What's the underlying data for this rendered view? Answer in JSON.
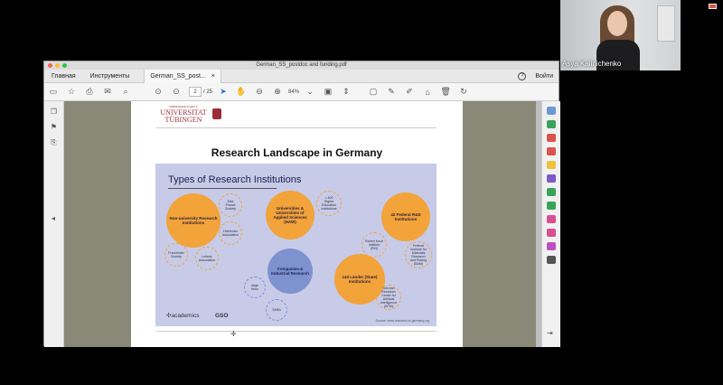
{
  "video": {
    "participant_name": "Asya Kalinichenko"
  },
  "window": {
    "title": "German_SS_postdoc and funding.pdf",
    "menu": [
      "Главная",
      "Инструменты"
    ],
    "tab_label": "German_SS_post...",
    "sign_in": "Войти"
  },
  "toolbar": {
    "page_current": "2",
    "page_total": "/ 25",
    "zoom": "84%"
  },
  "pdf": {
    "logo_line1": "EBERHARD KARLS",
    "logo_line2": "UNIVERSITAT",
    "logo_line3": "TÜBINGEN",
    "slide_title": "Research Landscape in Germany",
    "slide": {
      "subtitle": "Types of Research Institutions",
      "circles": {
        "non_university": "Non-university Research Institutions",
        "universities": "Universities & Universities of Applied Sciences (HAW)",
        "federal": "42 Federal R&D Institutions",
        "companies": "Companies & Industrial Research",
        "laender": "143 Länder (State) Institutions",
        "max_planck": "Max Planck Society",
        "helmholtz": "Helmholtz Association",
        "fraunhofer": "Fraunhofer Society",
        "leibniz": "Leibniz Association",
        "higher_ed": "> 400 Higher Education Institutions",
        "robert_koch": "Robert Koch Institute (RKI)",
        "bam": "Federal Institute for Materials Research and Testing (BAM)",
        "large_firms": "large firms",
        "smes": "SMEs",
        "dfki": "German Research Center for Artificial Intelligence (DFKI)"
      },
      "brand1": "academics",
      "brand2": "GSO",
      "source": "Source: www.research-in-germany.org"
    }
  },
  "colors": {
    "orange": "#f2a33a",
    "blue": "#7e92d0",
    "slide_bg": "#c7cbe8",
    "uni_red": "#9a2d3a"
  }
}
